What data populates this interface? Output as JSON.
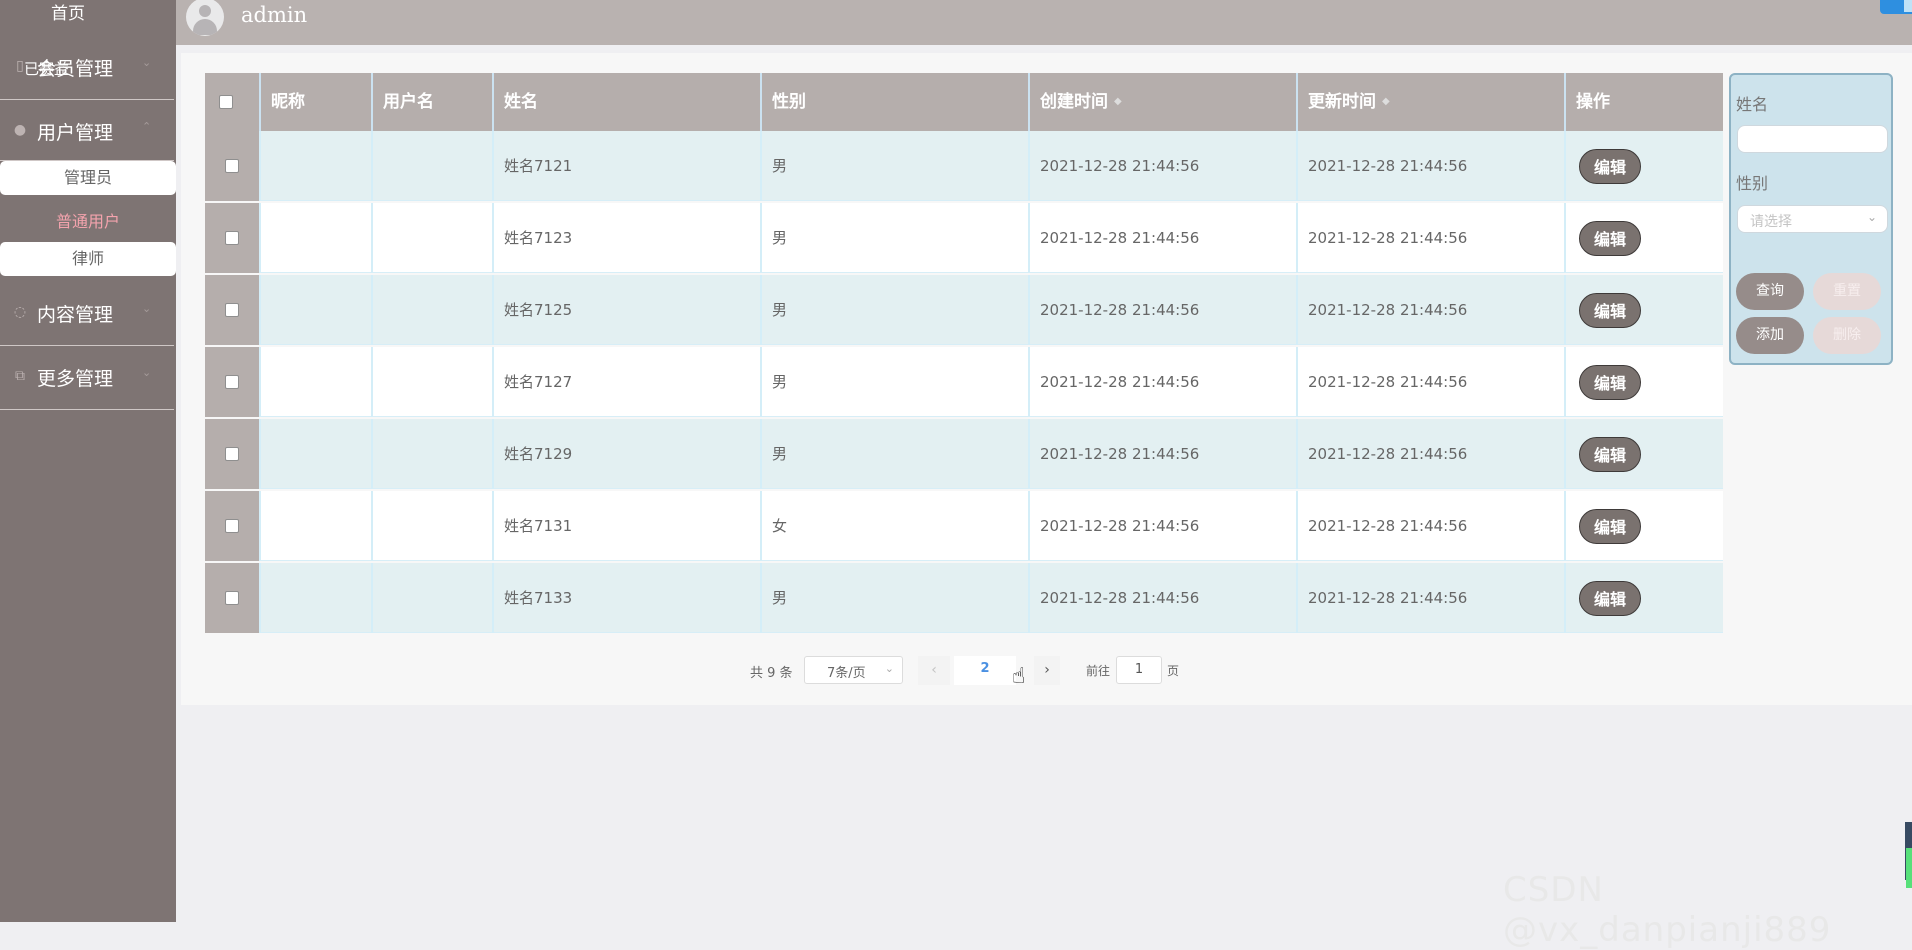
{
  "header": {
    "username": "admin"
  },
  "sidebar": {
    "home_label": "首页",
    "overlay_text": "已赛益",
    "menus": [
      {
        "label": "会员管理",
        "icon": "file-icon"
      },
      {
        "label": "用户管理",
        "icon": "user-icon"
      },
      {
        "label": "内容管理",
        "icon": "chat-icon"
      },
      {
        "label": "更多管理",
        "icon": "copy-icon"
      }
    ],
    "submenu": [
      {
        "label": "管理员",
        "state": "highlight"
      },
      {
        "label": "普通用户",
        "state": "current"
      },
      {
        "label": "律师",
        "state": "highlight"
      }
    ]
  },
  "table": {
    "headers": [
      "昵称",
      "用户名",
      "姓名",
      "性别",
      "创建时间",
      "更新时间",
      "操作"
    ],
    "rows": [
      {
        "nickname": "",
        "username": "",
        "name": "姓名7121",
        "gender": "男",
        "created": "2021-12-28 21:44:56",
        "updated": "2021-12-28 21:44:56",
        "action": "编辑"
      },
      {
        "nickname": "",
        "username": "",
        "name": "姓名7123",
        "gender": "男",
        "created": "2021-12-28 21:44:56",
        "updated": "2021-12-28 21:44:56",
        "action": "编辑"
      },
      {
        "nickname": "",
        "username": "",
        "name": "姓名7125",
        "gender": "男",
        "created": "2021-12-28 21:44:56",
        "updated": "2021-12-28 21:44:56",
        "action": "编辑"
      },
      {
        "nickname": "",
        "username": "",
        "name": "姓名7127",
        "gender": "男",
        "created": "2021-12-28 21:44:56",
        "updated": "2021-12-28 21:44:56",
        "action": "编辑"
      },
      {
        "nickname": "",
        "username": "",
        "name": "姓名7129",
        "gender": "男",
        "created": "2021-12-28 21:44:56",
        "updated": "2021-12-28 21:44:56",
        "action": "编辑"
      },
      {
        "nickname": "",
        "username": "",
        "name": "姓名7131",
        "gender": "女",
        "created": "2021-12-28 21:44:56",
        "updated": "2021-12-28 21:44:56",
        "action": "编辑"
      },
      {
        "nickname": "",
        "username": "",
        "name": "姓名7133",
        "gender": "男",
        "created": "2021-12-28 21:44:56",
        "updated": "2021-12-28 21:44:56",
        "action": "编辑"
      }
    ]
  },
  "filter": {
    "name_label": "姓名",
    "gender_label": "性别",
    "gender_placeholder": "请选择",
    "query": "查询",
    "reset": "重置",
    "add": "添加",
    "delete": "删除"
  },
  "pagination": {
    "total": "共 9 条",
    "page_size": "7条/页",
    "current_page": "2",
    "goto_label": "前往",
    "goto_value": "1",
    "page_unit": "页"
  },
  "watermark": "CSDN @vx_danpianji889"
}
